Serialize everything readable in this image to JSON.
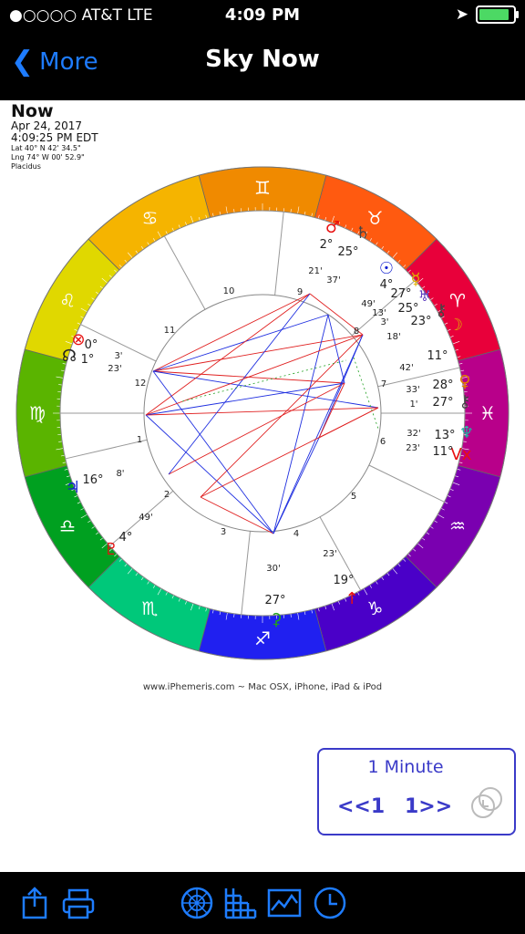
{
  "status_bar": {
    "carrier": "●○○○○ AT&T  LTE",
    "time": "4:09 PM"
  },
  "nav": {
    "back_label": "More",
    "title": "Sky Now"
  },
  "chart_info": {
    "name": "Now",
    "date": "Apr 24, 2017",
    "time": "4:09:25 PM EDT",
    "lat": "Lat 40° N 42' 34.5\"",
    "lng": "Lng 74° W 00' 52.9\"",
    "house_system": "Placidus"
  },
  "zodiac_signs": [
    {
      "glyph": "♊",
      "color": "#f08a00"
    },
    {
      "glyph": "♉",
      "color": "#ff5a10"
    },
    {
      "glyph": "♈",
      "color": "#e8003a"
    },
    {
      "glyph": "♓",
      "color": "#b8008a"
    },
    {
      "glyph": "♒",
      "color": "#7a00b0"
    },
    {
      "glyph": "♑",
      "color": "#4a00c8"
    },
    {
      "glyph": "♐",
      "color": "#2020f0"
    },
    {
      "glyph": "♏",
      "color": "#00c87a"
    },
    {
      "glyph": "♎",
      "color": "#00a020"
    },
    {
      "glyph": "♍",
      "color": "#5ab400"
    },
    {
      "glyph": "♌",
      "color": "#e0d800"
    },
    {
      "glyph": "♋",
      "color": "#f5b400"
    }
  ],
  "house_numbers": [
    "1",
    "2",
    "3",
    "4",
    "5",
    "6",
    "7",
    "8",
    "9",
    "10",
    "11",
    "12"
  ],
  "planet_labels": [
    {
      "text": "♂",
      "color": "#e81010"
    },
    {
      "text": "2°",
      "color": "#222"
    },
    {
      "text": "21'",
      "color": "#222"
    },
    {
      "text": "♄",
      "color": "#444"
    },
    {
      "text": "25°",
      "color": "#222"
    },
    {
      "text": "37'",
      "color": "#222"
    },
    {
      "text": "☉",
      "color": "#1020d0"
    },
    {
      "text": "4°",
      "color": "#222"
    },
    {
      "text": "49'",
      "color": "#222"
    },
    {
      "text": "☿",
      "color": "#e0b000"
    },
    {
      "text": "27°",
      "color": "#222"
    },
    {
      "text": "13'",
      "color": "#222"
    },
    {
      "text": "♅",
      "color": "#6040c0"
    },
    {
      "text": "25°",
      "color": "#222"
    },
    {
      "text": "3'",
      "color": "#222"
    },
    {
      "text": "⚷",
      "color": "#444"
    },
    {
      "text": "23°",
      "color": "#222"
    },
    {
      "text": "18'",
      "color": "#222"
    },
    {
      "text": "☽",
      "color": "#e0b000"
    },
    {
      "text": "11°",
      "color": "#222"
    },
    {
      "text": "42'",
      "color": "#222"
    },
    {
      "text": "♀",
      "color": "#e08000"
    },
    {
      "text": "28°",
      "color": "#222"
    },
    {
      "text": "33'",
      "color": "#222"
    },
    {
      "text": "⚷",
      "color": "#444"
    },
    {
      "text": "27°",
      "color": "#222"
    },
    {
      "text": "1'",
      "color": "#222"
    },
    {
      "text": "♆",
      "color": "#20b0a0"
    },
    {
      "text": "13°",
      "color": "#222"
    },
    {
      "text": "32'",
      "color": "#222"
    },
    {
      "text": "Vx",
      "color": "#e81010"
    },
    {
      "text": "11°",
      "color": "#222"
    },
    {
      "text": "23'",
      "color": "#222"
    },
    {
      "text": "⊗",
      "color": "#e81010"
    },
    {
      "text": "0°",
      "color": "#222"
    },
    {
      "text": "3'",
      "color": "#222"
    },
    {
      "text": "☊",
      "color": "#222"
    },
    {
      "text": "1°",
      "color": "#222"
    },
    {
      "text": "23'",
      "color": "#222"
    },
    {
      "text": "♃",
      "color": "#1020d0"
    },
    {
      "text": "16°",
      "color": "#222"
    },
    {
      "text": "8'",
      "color": "#222"
    },
    {
      "text": "♇",
      "color": "#e81010"
    },
    {
      "text": "4°",
      "color": "#222"
    },
    {
      "text": "49'",
      "color": "#222"
    },
    {
      "text": "30'",
      "color": "#222"
    },
    {
      "text": "27°",
      "color": "#222"
    },
    {
      "text": "⚳",
      "color": "#20a020"
    },
    {
      "text": "23'",
      "color": "#222"
    },
    {
      "text": "19°",
      "color": "#222"
    },
    {
      "text": "↑",
      "color": "#e81010"
    }
  ],
  "credit": "www.iPhemeris.com ~ Mac OSX, iPhone, iPad & iPod",
  "time_step": {
    "step_label": "1 Minute",
    "prev_label": "<<1",
    "next_label": "1>>"
  },
  "toolbar_icons": [
    "share-icon",
    "print-icon",
    "wheel-icon",
    "grid-icon",
    "graph-icon",
    "clock-icon"
  ]
}
